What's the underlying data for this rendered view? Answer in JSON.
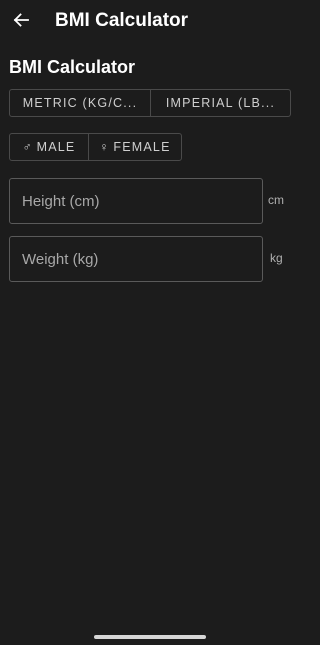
{
  "app_bar": {
    "title": "BMI Calculator",
    "back_icon": "arrow-left-icon"
  },
  "section": {
    "title": "BMI Calculator"
  },
  "unit_toggle": {
    "metric_label": "METRIC (KG/C...",
    "imperial_label": "IMPERIAL (LB..."
  },
  "gender_toggle": {
    "male_symbol": "♂",
    "male_label": "MALE",
    "female_symbol": "♀",
    "female_label": "FEMALE"
  },
  "height": {
    "placeholder": "Height (cm)",
    "value": "",
    "unit": "cm"
  },
  "weight": {
    "placeholder": "Weight (kg)",
    "value": "",
    "unit": "kg"
  },
  "colors": {
    "background": "#1c1c1c",
    "border": "#4a4a4a",
    "text": "#ffffff",
    "muted_text": "#a8a8a8"
  }
}
